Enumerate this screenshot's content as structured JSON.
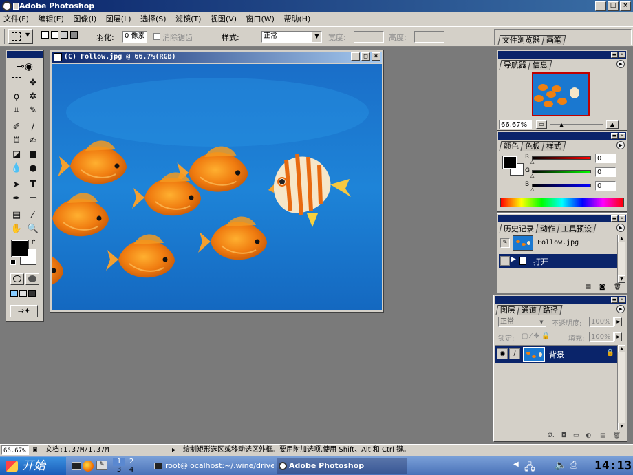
{
  "window": {
    "title": "Adobe Photoshop"
  },
  "menu": [
    "文件(F)",
    "编辑(E)",
    "图像(I)",
    "图层(L)",
    "选择(S)",
    "滤镜(T)",
    "视图(V)",
    "窗口(W)",
    "帮助(H)"
  ],
  "options": {
    "feather_label": "羽化:",
    "feather_value": "0 像素",
    "antialias_label": "消除锯齿",
    "style_label": "样式:",
    "style_value": "正常",
    "width_label": "宽度:",
    "height_label": "高度:"
  },
  "palette_well": {
    "tabs": [
      "文件浏览器",
      "画笔"
    ]
  },
  "document": {
    "title": "(C) Follow.jpg @ 66.7%(RGB)"
  },
  "navigator": {
    "tabs": [
      "导航器",
      "信息"
    ],
    "zoom": "66.67%"
  },
  "color": {
    "tabs": [
      "颜色",
      "色板",
      "样式"
    ],
    "channels": [
      {
        "label": "R",
        "value": "0"
      },
      {
        "label": "G",
        "value": "0"
      },
      {
        "label": "B",
        "value": "0"
      }
    ]
  },
  "history": {
    "tabs": [
      "历史记录",
      "动作",
      "工具预设"
    ],
    "snapshot": "Follow.jpg",
    "states": [
      "打开"
    ]
  },
  "layers": {
    "tabs": [
      "图层",
      "通道",
      "路径"
    ],
    "blend_mode": "正常",
    "opacity_label": "不透明度:",
    "opacity_value": "100%",
    "lock_label": "锁定:",
    "fill_label": "填充:",
    "fill_value": "100%",
    "items": [
      {
        "name": "背景"
      }
    ]
  },
  "status": {
    "zoom": "66.67%",
    "doc": "文档:1.37M/1.37M",
    "hint": "绘制矩形选区或移动选区外框。要用附加选项,使用 Shift、Alt 和 Ctrl 键。"
  },
  "taskbar": {
    "start": "开始",
    "workspaces": [
      "1",
      "2",
      "3",
      "4"
    ],
    "tasks": [
      "root@localhost:~/.wine/drive_c/",
      "Adobe Photoshop"
    ],
    "clock": "14:13"
  },
  "colors": {
    "titlebar": "#0a246a",
    "face": "#d4d0c8",
    "canvas_bg": "#7a7a7a",
    "selection": "#0a246a",
    "water": "#1a78d0",
    "fish": "#f08010"
  },
  "icons": [
    "photoshop-eye-icon",
    "marquee-icon",
    "move-icon",
    "lasso-icon",
    "magic-wand-icon",
    "crop-icon",
    "slice-icon",
    "brush-icon",
    "stamp-icon",
    "eraser-icon",
    "gradient-icon",
    "dodge-icon",
    "path-select-icon",
    "type-icon",
    "pen-icon",
    "shape-icon",
    "notes-icon",
    "eyedropper-icon",
    "hand-icon",
    "zoom-icon",
    "eye-icon",
    "lock-icon",
    "trash-icon",
    "new-layer-icon"
  ]
}
